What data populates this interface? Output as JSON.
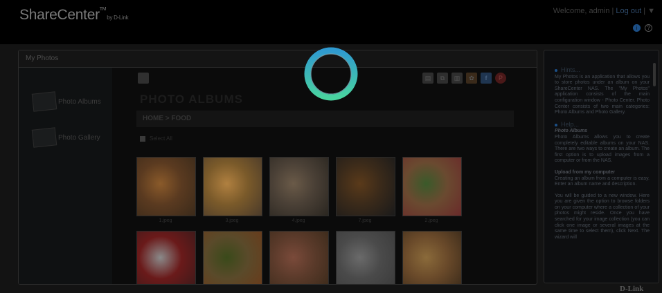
{
  "app": {
    "name": "ShareCenter",
    "tm": "TM",
    "by": "by D-Link"
  },
  "header": {
    "welcome_text": "Welcome, admin |",
    "logout_label": "Log out",
    "separator": "|",
    "menu_arrow": "▼",
    "info_icon": "i",
    "help_icon": "?"
  },
  "panel": {
    "title": "My Photos"
  },
  "nav": {
    "items": [
      {
        "label": "Photo Albums",
        "icon": "photo-albums-icon"
      },
      {
        "label": "Photo Gallery",
        "icon": "photo-gallery-icon"
      }
    ]
  },
  "content": {
    "page_title": "PHOTO ALBUMS",
    "breadcrumb": "HOME > FOOD",
    "select_all": "Select All",
    "toolbar_icons": [
      "edit-icon",
      "upload-icon",
      "delete-icon",
      "picasa-icon",
      "facebook-icon",
      "pinterest-icon"
    ],
    "photos": [
      {
        "label": "1.jpeg",
        "colors": [
          "#5a3a20",
          "#8a5a2a",
          "#3a2a1a"
        ]
      },
      {
        "label": "3.jpeg",
        "colors": [
          "#7a5a2a",
          "#b08040",
          "#4a3a2a"
        ]
      },
      {
        "label": "4.jpeg",
        "colors": [
          "#4a4036",
          "#6a5a48",
          "#2a2620"
        ]
      },
      {
        "label": "7.jpeg",
        "colors": [
          "#3a2a1a",
          "#5a3a1a",
          "#1a1a1a"
        ]
      },
      {
        "label": "2.jpeg",
        "colors": [
          "#6a4a30",
          "#3a5a2a",
          "#6a2a2a"
        ]
      },
      {
        "label": "",
        "colors": [
          "#6a1a1a",
          "#8a8a8a",
          "#3a1a1a"
        ]
      },
      {
        "label": "",
        "colors": [
          "#5a4a2a",
          "#3a4a1a",
          "#6a3a1a"
        ]
      },
      {
        "label": "",
        "colors": [
          "#5a3a2a",
          "#7a4a3a",
          "#3a2a1a"
        ]
      },
      {
        "label": "",
        "colors": [
          "#4a4a4a",
          "#6a6a6a",
          "#3a3a3a"
        ]
      },
      {
        "label": "",
        "colors": [
          "#6a4a2a",
          "#8a6a3a",
          "#3a2a1a"
        ]
      }
    ]
  },
  "hints": {
    "title": "Hints...",
    "body": "My Photos is an application that allows you to store photos under an album on your ShareCenter NAS. The \"My Photos\" application consists of the main configuration window - Photo Center. Photo Center consists of two main categories: Photo Albums and Photo Gallery."
  },
  "help": {
    "title": "Help...",
    "subtitle": "Photo Albums",
    "body": "Photo Albums allows you to create completely editable albums on your NAS. There are two ways to create an album. The first option is to upload images from a computer or from the NAS.",
    "upload_title": "Upload from my computer",
    "upload_body": "Creating an album from a computer is easy. Enter an album name and description.",
    "guide_body": "You will be guided to a new window. Here you are given the option to browse folders on your computer where a collection of your photos might reside. Once you have searched for your image collection (you can click one image or several images at the same time to select them), click Next. The wizard will"
  },
  "brand": {
    "footer": "D-Link"
  },
  "colors": {
    "spinner_outer": "#2f9ad0",
    "spinner_inner": "#49d3a0",
    "accent": "#1c4f86"
  }
}
